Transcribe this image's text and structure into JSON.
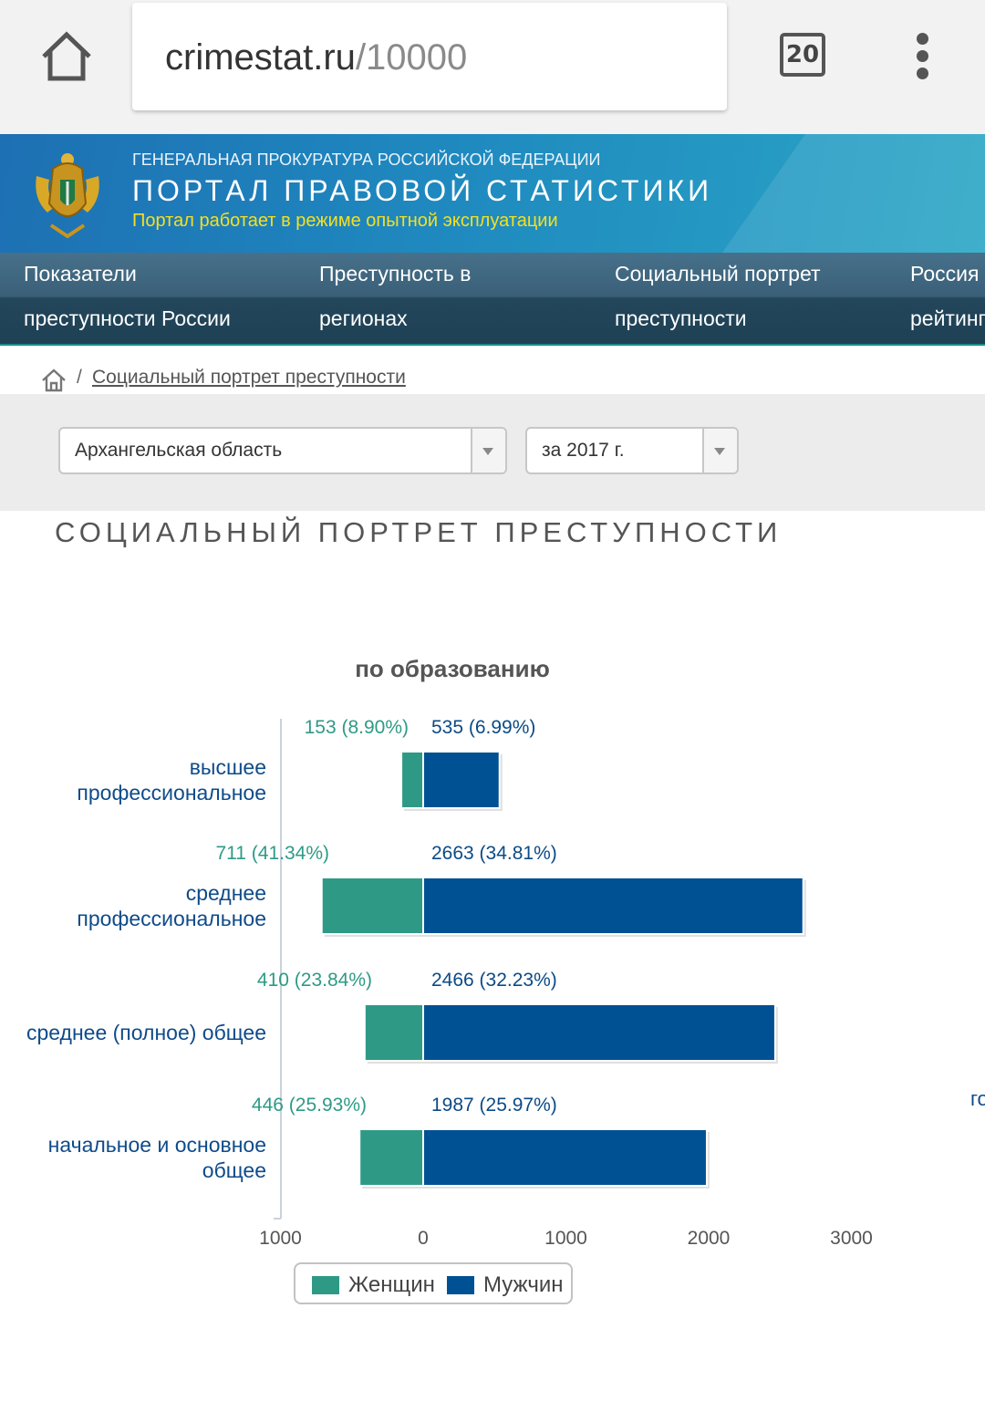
{
  "browser": {
    "url_host": "crimestat.ru",
    "url_path": "/10000",
    "tabs_count": "20",
    "icons": [
      "home-icon",
      "tabs-icon",
      "more-vert-icon"
    ]
  },
  "header": {
    "org": "ГЕНЕРАЛЬНАЯ ПРОКУРАТУРА РОССИЙСКОЙ ФЕДЕРАЦИИ",
    "title": "ПОРТАЛ ПРАВОВОЙ СТАТИСТИКИ",
    "notice": "Портал работает в режиме опытной эксплуатации",
    "logo": "emblem-icon",
    "colors": {
      "bg_start": "#1d70b3",
      "bg_end": "#2aa6c6",
      "notice": "#f4e020"
    }
  },
  "nav": {
    "items": [
      {
        "line1": "Показатели",
        "line2": "преступности России"
      },
      {
        "line1": "Преступность в",
        "line2": "регионах"
      },
      {
        "line1": "Социальный портрет",
        "line2": "преступности"
      },
      {
        "line1": "Россия",
        "line2": "рейтинг"
      }
    ]
  },
  "breadcrumb": {
    "separator": "/",
    "current": "Социальный портрет преступности"
  },
  "filters": {
    "region": "Архангельская область",
    "year": "за 2017 г."
  },
  "section_title": "СОЦИАЛЬНЫЙ ПОРТРЕТ ПРЕСТУПНОСТИ",
  "chart_title": "по образованию",
  "partial_right_text": "го",
  "chart_data": {
    "type": "bar",
    "orientation": "horizontal",
    "stacked": true,
    "title": "по образованию",
    "categories": [
      "высшее профессиональное",
      "среднее профессиональное",
      "среднее (полное) общее",
      "начальное и основное общее"
    ],
    "series": [
      {
        "name": "Женщин",
        "color": "#2e9a86",
        "values": [
          153,
          711,
          410,
          446
        ],
        "labels": [
          "153 (8.90%)",
          "711 (41.34%)",
          "410 (23.84%)",
          "446 (25.93%)"
        ]
      },
      {
        "name": "Мужчин",
        "color": "#005193",
        "values": [
          535,
          2663,
          2466,
          1987
        ],
        "labels": [
          "535 (6.99%)",
          "2663 (34.81%)",
          "2466 (32.23%)",
          "1987 (25.97%)"
        ]
      }
    ],
    "xlim": [
      -1000,
      3000
    ],
    "xticks": [
      {
        "value": -1000,
        "label": "1000"
      },
      {
        "value": 0,
        "label": "0"
      },
      {
        "value": 1000,
        "label": "1000"
      },
      {
        "value": 2000,
        "label": "2000"
      },
      {
        "value": 3000,
        "label": "3000"
      }
    ],
    "legend_position": "bottom"
  }
}
